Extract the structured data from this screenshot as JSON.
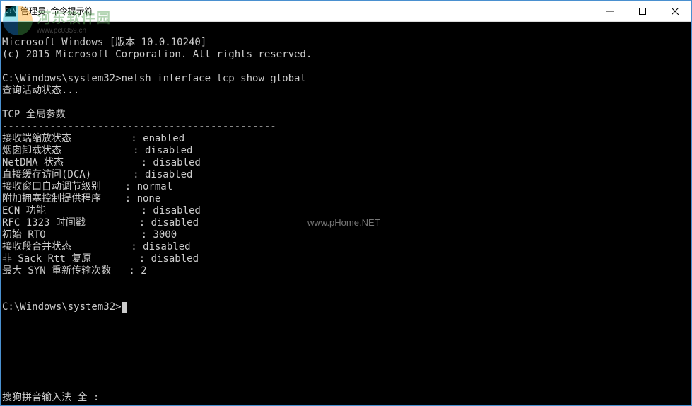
{
  "titlebar": {
    "icon_glyph": "C:\\",
    "title": "管理员: 命令提示符"
  },
  "logo": {
    "main": "河东软件园",
    "sub": "www.pc0359.cn"
  },
  "terminal": {
    "banner_line1": "Microsoft Windows [版本 10.0.10240]",
    "banner_line2": "(c) 2015 Microsoft Corporation. All rights reserved.",
    "prompt1": "C:\\Windows\\system32>",
    "command1": "netsh interface tcp show global",
    "query_line": "查询活动状态...",
    "section_title": "TCP 全局参数",
    "divider": "----------------------------------------------",
    "params": [
      {
        "label": "接收端缩放状态",
        "pad": "          ",
        "value": "enabled"
      },
      {
        "label": "烟囱卸载状态",
        "pad": "            ",
        "value": "disabled"
      },
      {
        "label": "NetDMA 状态",
        "pad": "             ",
        "value": "disabled"
      },
      {
        "label": "直接缓存访问(DCA)",
        "pad": "       ",
        "value": "disabled"
      },
      {
        "label": "接收窗口自动调节级别",
        "pad": "    ",
        "value": "normal"
      },
      {
        "label": "附加拥塞控制提供程序",
        "pad": "    ",
        "value": "none"
      },
      {
        "label": "ECN 功能",
        "pad": "                ",
        "value": "disabled"
      },
      {
        "label": "RFC 1323 时间戳",
        "pad": "         ",
        "value": "disabled"
      },
      {
        "label": "初始 RTO",
        "pad": "                ",
        "value": "3000"
      },
      {
        "label": "接收段合并状态",
        "pad": "          ",
        "value": "disabled"
      },
      {
        "label": "非 Sack Rtt 复原",
        "pad": "        ",
        "value": "disabled"
      },
      {
        "label": "最大 SYN 重新传输次数",
        "pad": "   ",
        "value": "2"
      }
    ],
    "prompt2": "C:\\Windows\\system32>",
    "ime_status": "搜狗拼音输入法 全 :"
  },
  "watermark": "www.pHome.NET"
}
